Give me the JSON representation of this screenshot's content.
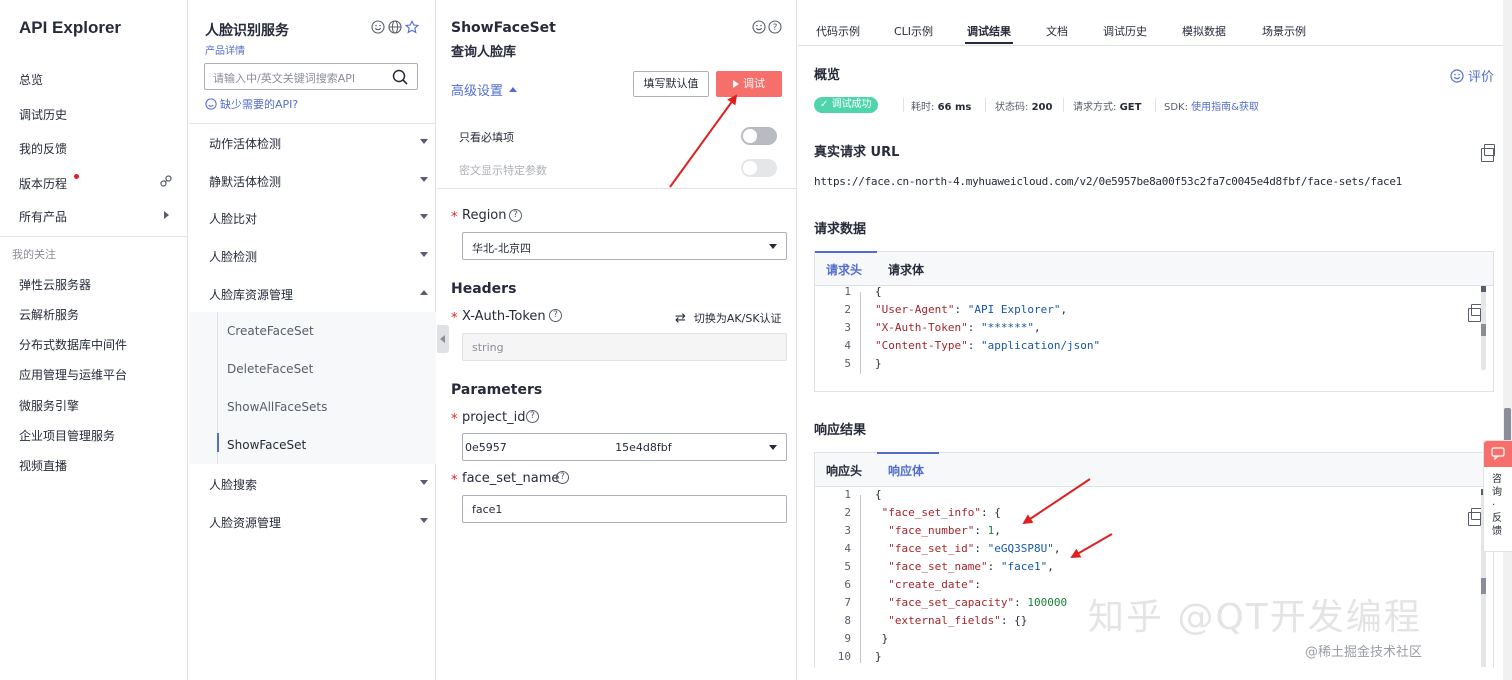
{
  "left_nav": {
    "brand": "API Explorer",
    "items": [
      "总览",
      "调试历史",
      "我的反馈",
      "版本历程",
      "所有产品"
    ],
    "section_title": "我的关注",
    "favorites": [
      "弹性云服务器",
      "云解析服务",
      "分布式数据库中间件",
      "应用管理与运维平台",
      "微服务引擎",
      "企业项目管理服务",
      "视频直播"
    ]
  },
  "service_panel": {
    "title": "人脸识别服务",
    "detail_link": "产品详情",
    "search_placeholder": "请输入中/英文关键词搜索API",
    "missing_api": "缺少需要的API?",
    "groups": [
      {
        "label": "动作活体检测",
        "expanded": false
      },
      {
        "label": "静默活体检测",
        "expanded": false
      },
      {
        "label": "人脸比对",
        "expanded": false
      },
      {
        "label": "人脸检测",
        "expanded": false
      },
      {
        "label": "人脸库资源管理",
        "expanded": true,
        "children": [
          "CreateFaceSet",
          "DeleteFaceSet",
          "ShowAllFaceSets",
          "ShowFaceSet"
        ]
      },
      {
        "label": "人脸搜索",
        "expanded": false
      },
      {
        "label": "人脸资源管理",
        "expanded": false
      }
    ],
    "active_child": "ShowFaceSet"
  },
  "params_panel": {
    "api_name": "ShowFaceSet",
    "api_desc": "查询人脸库",
    "advanced": "高级设置",
    "fill_default": "填写默认值",
    "debug": "调试",
    "only_required": "只看必填项",
    "show_encrypted": "密文显示特定参数",
    "region_label": "Region",
    "region_value": "华北-北京四",
    "headers_title": "Headers",
    "token_label": "X-Auth-Token",
    "switch_auth": "切换为AK/SK认证",
    "token_placeholder": "string",
    "parameters_title": "Parameters",
    "project_id_label": "project_id",
    "project_id_value": "0e5957                               15e4d8fbf",
    "face_set_name_label": "face_set_name",
    "face_set_name_value": "face1"
  },
  "result_panel": {
    "tabs": [
      "代码示例",
      "CLI示例",
      "调试结果",
      "文档",
      "调试历史",
      "模拟数据",
      "场景示例"
    ],
    "active_tab": "调试结果",
    "overview_title": "概览",
    "rate": "评价",
    "status_badge": "调试成功",
    "time_label": "耗时:",
    "time_value": "66 ms",
    "code_label": "状态码:",
    "code_value": "200",
    "method_label": "请求方式:",
    "method_value": "GET",
    "sdk_label": "SDK:",
    "sdk_link": "使用指南&获取",
    "url_title": "真实请求 URL",
    "url_value": "https://face.cn-north-4.myhuaweicloud.com/v2/0e5957be8a00f53c2fa7c0045e4d8fbf/face-sets/face1",
    "request_title": "请求数据",
    "request_tabs": [
      "请求头",
      "请求体"
    ],
    "request_lines": [
      {
        "no": "1",
        "segs": [
          [
            "p",
            "{"
          ]
        ]
      },
      {
        "no": "2",
        "segs": [
          [
            "k",
            "\"User-Agent\""
          ],
          [
            "p",
            ": "
          ],
          [
            "s",
            "\"API Explorer\""
          ],
          [
            "p",
            ","
          ]
        ]
      },
      {
        "no": "3",
        "segs": [
          [
            "k",
            "\"X-Auth-Token\""
          ],
          [
            "p",
            ": "
          ],
          [
            "s",
            "\"******\""
          ],
          [
            "p",
            ","
          ]
        ]
      },
      {
        "no": "4",
        "segs": [
          [
            "k",
            "\"Content-Type\""
          ],
          [
            "p",
            ": "
          ],
          [
            "s",
            "\"application/json\""
          ]
        ]
      },
      {
        "no": "5",
        "segs": [
          [
            "p",
            "}"
          ]
        ]
      }
    ],
    "response_title": "响应结果",
    "response_tabs": [
      "响应头",
      "响应体"
    ],
    "response_lines": [
      {
        "no": "1",
        "segs": [
          [
            "p",
            "{"
          ]
        ]
      },
      {
        "no": "2",
        "segs": [
          [
            "p",
            " "
          ],
          [
            "k",
            "\"face_set_info\""
          ],
          [
            "p",
            ": {"
          ]
        ]
      },
      {
        "no": "3",
        "segs": [
          [
            "p",
            "  "
          ],
          [
            "k",
            "\"face_number\""
          ],
          [
            "p",
            ": "
          ],
          [
            "n",
            "1"
          ],
          [
            "p",
            ","
          ]
        ]
      },
      {
        "no": "4",
        "segs": [
          [
            "p",
            "  "
          ],
          [
            "k",
            "\"face_set_id\""
          ],
          [
            "p",
            ": "
          ],
          [
            "s",
            "\"eGQ3SP8U\""
          ],
          [
            "p",
            ","
          ]
        ]
      },
      {
        "no": "5",
        "segs": [
          [
            "p",
            "  "
          ],
          [
            "k",
            "\"face_set_name\""
          ],
          [
            "p",
            ": "
          ],
          [
            "s",
            "\"face1\""
          ],
          [
            "p",
            ","
          ]
        ]
      },
      {
        "no": "6",
        "segs": [
          [
            "p",
            "  "
          ],
          [
            "k",
            "\"create_date\""
          ],
          [
            "p",
            ":"
          ]
        ]
      },
      {
        "no": "7",
        "segs": [
          [
            "p",
            "  "
          ],
          [
            "k",
            "\"face_set_capacity\""
          ],
          [
            "p",
            ": "
          ],
          [
            "n",
            "100000"
          ]
        ]
      },
      {
        "no": "8",
        "segs": [
          [
            "p",
            "  "
          ],
          [
            "k",
            "\"external_fields\""
          ],
          [
            "p",
            ": {}"
          ]
        ]
      },
      {
        "no": "9",
        "segs": [
          [
            "p",
            " }"
          ]
        ]
      },
      {
        "no": "10",
        "segs": [
          [
            "p",
            "}"
          ]
        ]
      }
    ]
  },
  "feedback_flag": "咨询·反馈",
  "watermark": {
    "main": "知乎 @QT开发编程",
    "sub": "@稀土掘金技术社区"
  },
  "colors": {
    "accent": "#526ecc",
    "danger": "#f66f6a",
    "success": "#50d4ab",
    "annotation": "#e02020"
  }
}
